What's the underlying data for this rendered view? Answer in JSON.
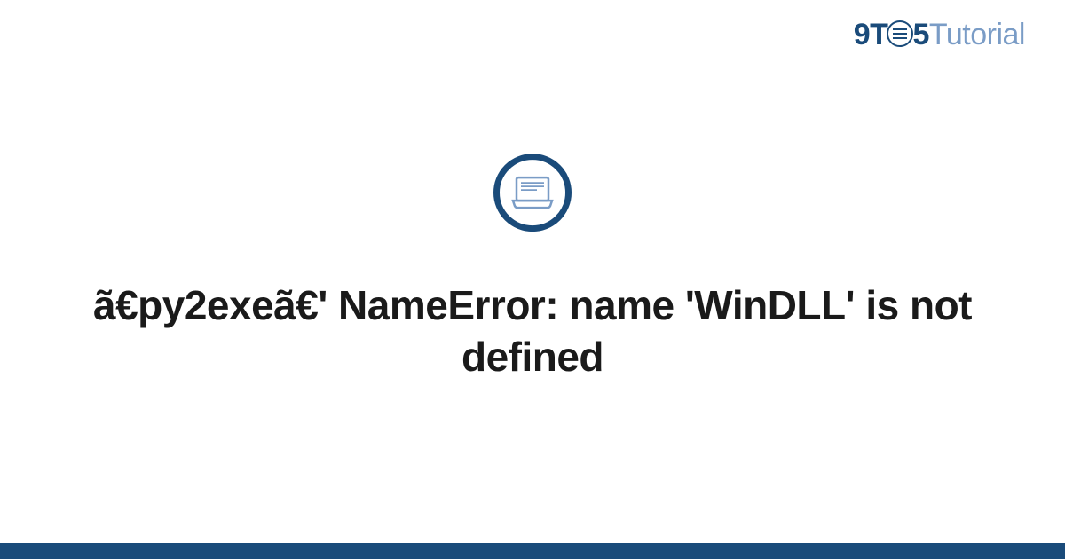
{
  "header": {
    "logo_part1": "9T",
    "logo_part2": "5",
    "logo_part3": "Tutorial"
  },
  "main": {
    "title": "ã€py2exeã€' NameError: name 'WinDLL' is not defined",
    "icon_name": "laptop-icon"
  },
  "colors": {
    "primary": "#1a4b7a",
    "secondary": "#7a9cc6",
    "text": "#1a1a1a"
  }
}
